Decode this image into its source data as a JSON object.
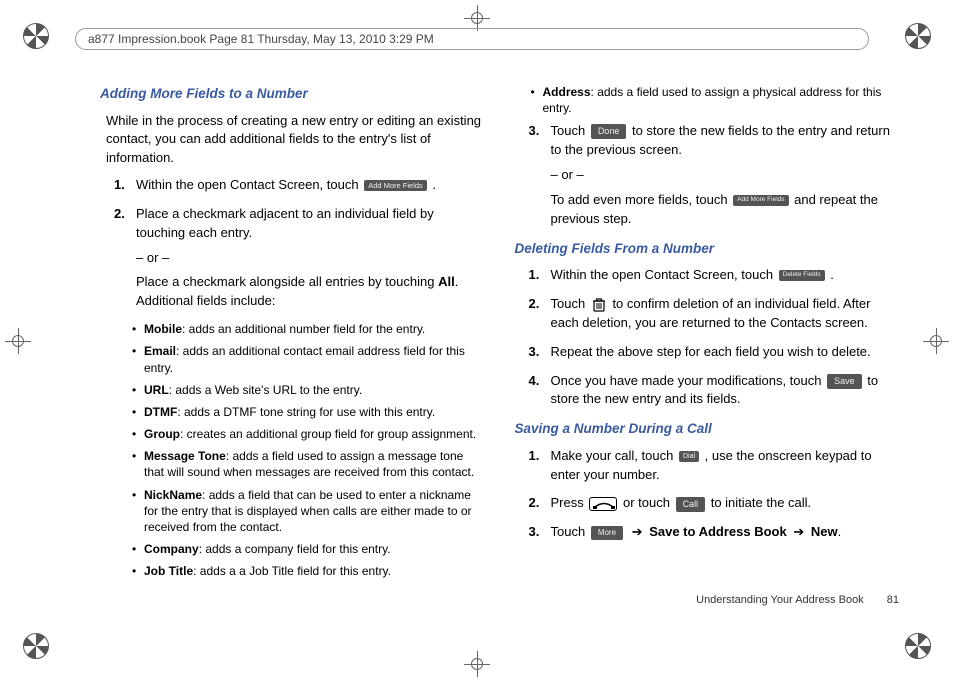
{
  "header": "a877 Impression.book  Page 81  Thursday, May 13, 2010  3:29 PM",
  "left": {
    "h1": "Adding More Fields to a Number",
    "intro": "While in the process of creating a new entry or editing an existing contact, you can add additional fields to the entry's list of information.",
    "s1a": "Within the open Contact Screen, touch ",
    "s1btn": "Add More Fields",
    "s1b": ".",
    "s2a": "Place a checkmark adjacent to an individual field by touching each entry.",
    "or": "– or –",
    "s2b_pre": "Place a checkmark alongside all entries by touching ",
    "s2b_bold": "All",
    "s2b_post": ". Additional fields include:",
    "fields": [
      {
        "n": "Mobile",
        "d": ": adds an additional number field for the entry."
      },
      {
        "n": "Email",
        "d": ": adds an additional contact email address field for this entry."
      },
      {
        "n": "URL",
        "d": ": adds a Web site's URL to the entry."
      },
      {
        "n": "DTMF",
        "d": ": adds a DTMF tone string for use with this entry."
      },
      {
        "n": "Group",
        "d": ": creates an additional group field for group assignment."
      },
      {
        "n": "Message Tone",
        "d": ": adds a field used to assign a message tone that will sound when messages are received from this contact."
      },
      {
        "n": "NickName",
        "d": ": adds a field that can be used to enter a nickname for the entry that is displayed when calls are either made to or received from the contact."
      },
      {
        "n": "Company",
        "d": ": adds a company field for this entry."
      },
      {
        "n": "Job Title",
        "d": ": adds a a Job Title field for this entry."
      }
    ]
  },
  "right": {
    "addr": {
      "n": "Address",
      "d": ": adds a field used to assign a physical address for this entry."
    },
    "s3a": "Touch ",
    "s3btn": "Done",
    "s3b": " to store the new fields to the entry and return to the previous screen.",
    "or": "– or –",
    "s3c_pre": "To add even more fields, touch ",
    "s3c_btn": "Add More Fields",
    "s3c_post": " and repeat the previous step.",
    "h2": "Deleting Fields From a Number",
    "d1a": "Within the open Contact Screen, touch ",
    "d1btn": "Delete Fields",
    "d1b": ".",
    "d2": "Touch  ",
    "d2post": "  to confirm deletion of an individual field. After each deletion, you are returned to the Contacts screen.",
    "d3": "Repeat the above step for each field you wish to delete.",
    "d4a": "Once you have made your modifications, touch ",
    "d4btn": "Save",
    "d4b": " to store the new entry and its fields.",
    "h3": "Saving a Number During a Call",
    "c1a": "Make your call, touch ",
    "c1btn": "Dial",
    "c1b": ", use the onscreen keypad to enter your number.",
    "c2a": "Press ",
    "c2b": " or touch ",
    "c2btn": "Call",
    "c2c": " to initiate the call.",
    "c3a": "Touch ",
    "c3btn": "More",
    "c3arrow": "➔",
    "c3b": "Save to Address Book",
    "c3arrow2": "➔",
    "c3c": "New",
    "c3d": "."
  },
  "footer": {
    "section": "Understanding Your Address Book",
    "page": "81"
  }
}
